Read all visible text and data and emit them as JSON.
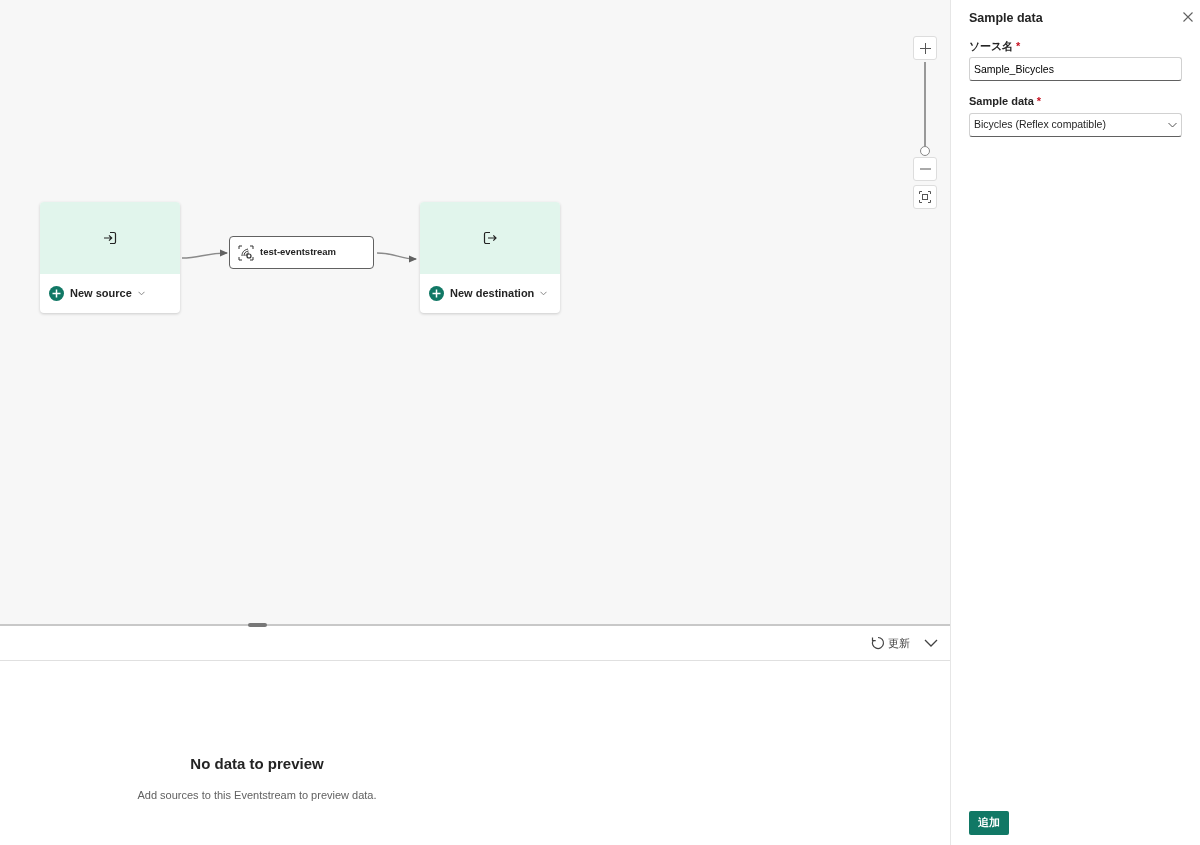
{
  "canvas": {
    "zoom": {
      "level": 0
    },
    "source_node": {
      "label": "New source"
    },
    "eventstream_node": {
      "label": "test-eventstream"
    },
    "destination_node": {
      "label": "New destination"
    }
  },
  "preview": {
    "refresh_label": "更新",
    "empty_title": "No data to preview",
    "empty_message": "Add sources to this Eventstream to preview data."
  },
  "panel": {
    "title": "Sample data",
    "fields": [
      {
        "kind": "text",
        "label": "ソース名",
        "required_mark": "*",
        "value": "Sample_Bicycles"
      },
      {
        "kind": "select",
        "label": "Sample data",
        "required_mark": "*",
        "value": "Bicycles (Reflex compatible)"
      }
    ],
    "submit_label": "追加"
  }
}
